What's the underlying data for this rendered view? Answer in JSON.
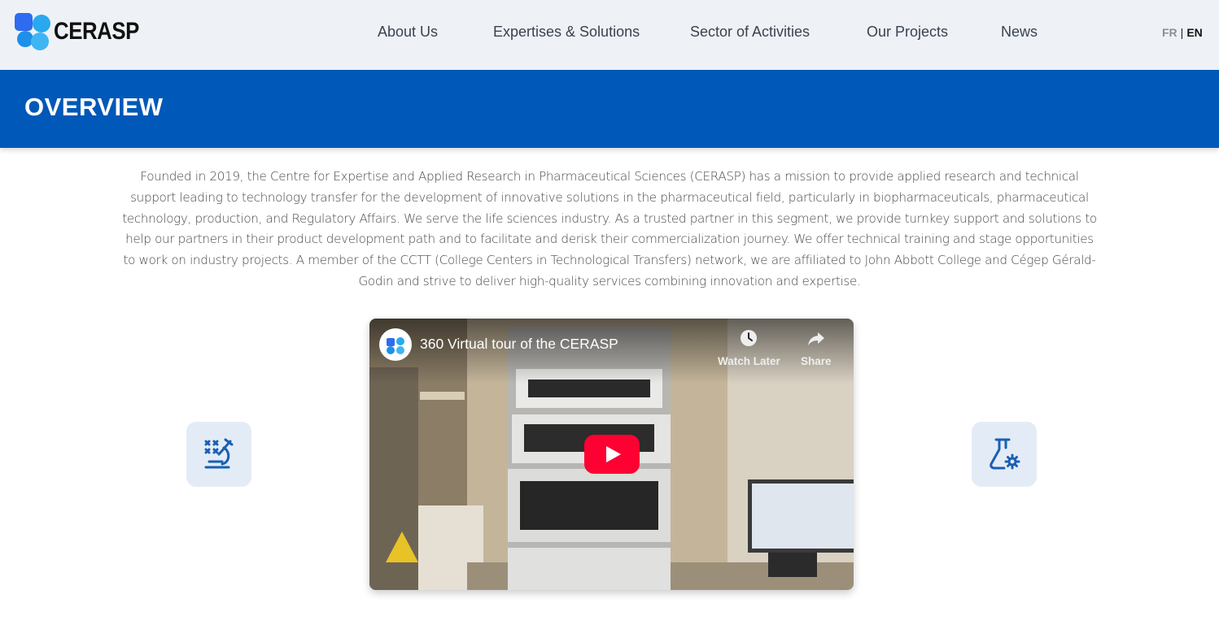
{
  "header": {
    "logo_text": "CERASP",
    "nav": [
      {
        "label": "About Us"
      },
      {
        "label": "Expertises & Solutions"
      },
      {
        "label": "Sector of Activities"
      },
      {
        "label": "Our Projects"
      },
      {
        "label": "News"
      }
    ],
    "lang": {
      "fr": "FR",
      "separator": "|",
      "en": "EN"
    }
  },
  "banner": {
    "title": "OVERVIEW"
  },
  "intro": {
    "text": "Founded in 2019, the Centre for Expertise and Applied Research in Pharmaceutical Sciences (CERASP) has a mission to provide applied research and technical support leading to technology transfer for the development of innovative solutions in the pharmaceutical field, particularly in biopharmaceuticals, pharmaceutical technology, production, and Regulatory Affairs. We serve the life sciences industry. As a trusted partner in this segment, we provide turnkey support and solutions to help our partners in their product development path and to facilitate and derisk their commercialization journey. We offer technical training and stage opportunities to work on industry projects. A member of the CCTT (College Centers in Technological Transfers) network, we are affiliated to John Abbott College and Cégep Gérald-Godin and strive to deliver high-quality services combining innovation and expertise."
  },
  "video": {
    "title": "360 Virtual tour of the CERASP",
    "watch_later": "Watch Later",
    "share": "Share",
    "play_icon": "play-icon"
  },
  "side_icons": {
    "left": "microscope-icon",
    "right": "flask-gear-icon"
  },
  "colors": {
    "brand_blue": "#0058b8",
    "header_bg": "#eef2f6",
    "icon_tile": "#e3ecf6",
    "youtube_red": "#ff0033"
  }
}
